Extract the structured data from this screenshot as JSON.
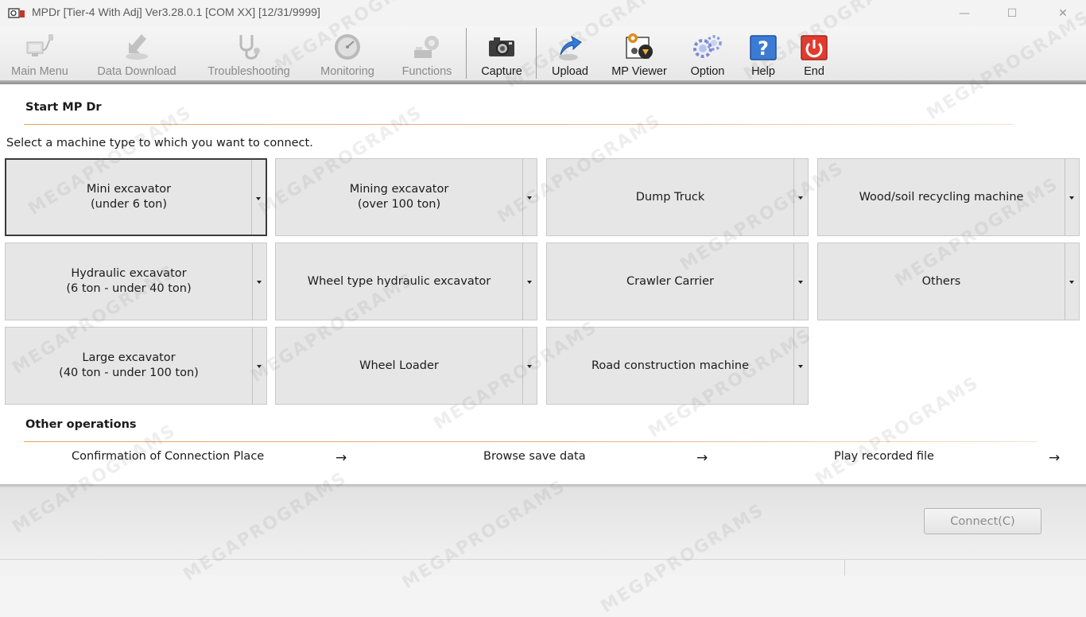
{
  "window": {
    "title": "MPDr [Tier-4 With Adj] Ver3.28.0.1 [COM XX] [12/31/9999]",
    "minimize": "—",
    "maximize": "☐",
    "close": "✕"
  },
  "toolbar": {
    "items": [
      {
        "label": "Main Menu",
        "icon": "computer-plug-icon",
        "enabled": false
      },
      {
        "label": "Data Download",
        "icon": "download-arrow-icon",
        "enabled": false
      },
      {
        "label": "Troubleshooting",
        "icon": "stethoscope-icon",
        "enabled": false
      },
      {
        "label": "Monitoring",
        "icon": "gauge-icon",
        "enabled": false
      },
      {
        "label": "Functions",
        "icon": "tools-gear-icon",
        "enabled": false
      },
      {
        "label": "Capture",
        "icon": "camera-icon",
        "enabled": true
      },
      {
        "label": "Upload",
        "icon": "upload-arrow-icon",
        "enabled": true
      },
      {
        "label": "MP Viewer",
        "icon": "viewer-gear-icon",
        "enabled": true
      },
      {
        "label": "Option",
        "icon": "option-gears-icon",
        "enabled": true
      },
      {
        "label": "Help",
        "icon": "help-icon",
        "enabled": true
      },
      {
        "label": "End",
        "icon": "power-icon",
        "enabled": true
      }
    ]
  },
  "start": {
    "heading": "Start MP Dr",
    "instruction": "Select a machine type to which you want to connect.",
    "tiles": [
      {
        "line1": "Mini excavator",
        "line2": "(under 6 ton)",
        "selected": true
      },
      {
        "line1": "Mining excavator",
        "line2": "(over 100 ton)"
      },
      {
        "line1": "Dump Truck",
        "line2": ""
      },
      {
        "line1": "Wood/soil recycling machine",
        "line2": ""
      },
      {
        "line1": "Hydraulic excavator",
        "line2": "(6 ton - under 40 ton)"
      },
      {
        "line1": "Wheel type hydraulic excavator",
        "line2": ""
      },
      {
        "line1": "Crawler Carrier",
        "line2": ""
      },
      {
        "line1": "Others",
        "line2": ""
      },
      {
        "line1": "Large excavator",
        "line2": "(40 ton - under 100 ton)"
      },
      {
        "line1": "Wheel Loader",
        "line2": ""
      },
      {
        "line1": "Road construction machine",
        "line2": ""
      }
    ]
  },
  "other": {
    "heading": "Other operations",
    "items": [
      {
        "label": "Confirmation of Connection Place",
        "arrow": "→"
      },
      {
        "label": "Browse save data",
        "arrow": "→"
      },
      {
        "label": "Play recorded file",
        "arrow": "→"
      }
    ]
  },
  "footer": {
    "connect_label": "Connect(C)"
  },
  "watermark": "MEGAPROGRAMS",
  "colors": {
    "accent_rule": "#e8a060",
    "tile_bg": "#e6e6e6",
    "end_red": "#e23b2e",
    "help_blue": "#3a7bd5"
  }
}
